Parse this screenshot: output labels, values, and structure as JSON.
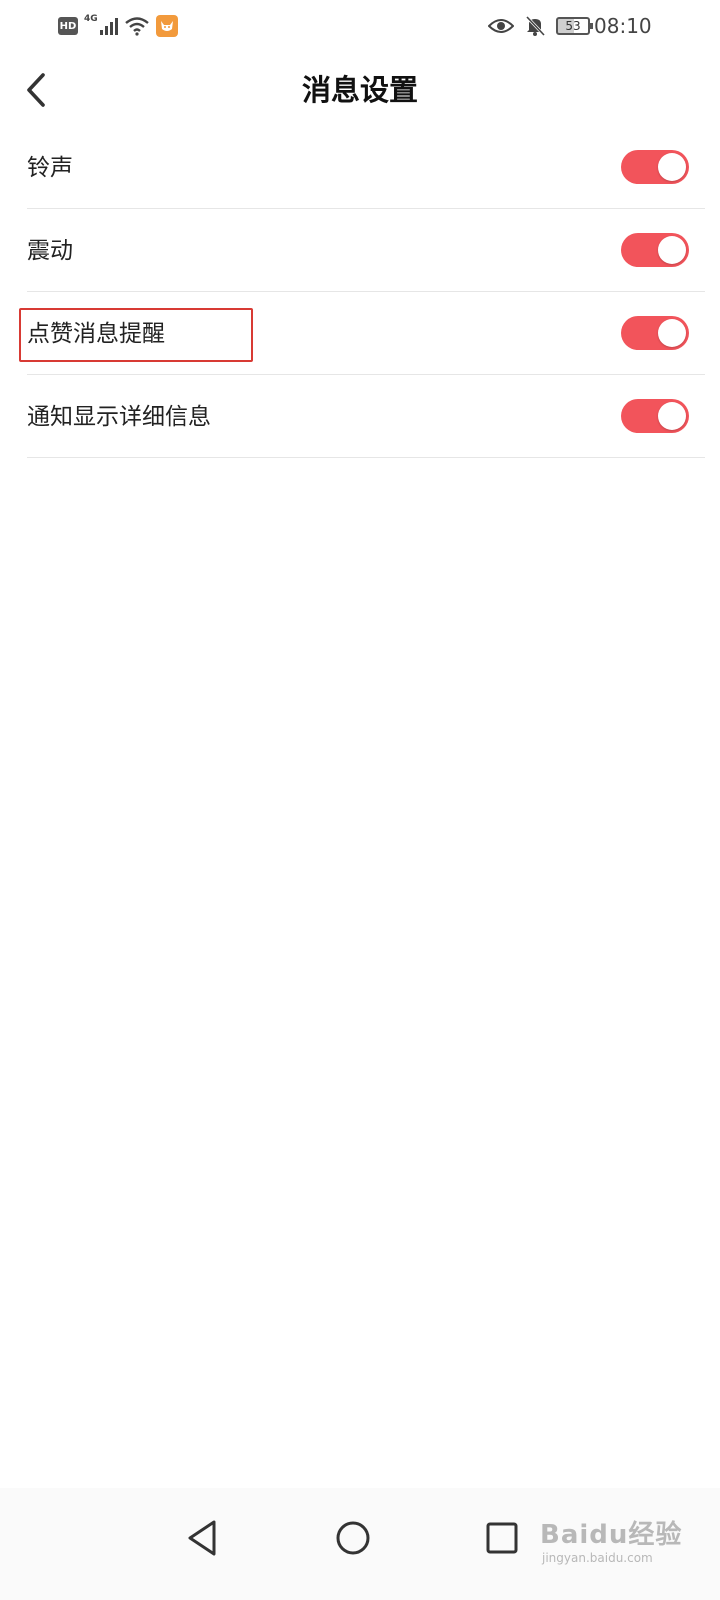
{
  "status_bar": {
    "hd": "HD",
    "network": "4G",
    "battery_level": "53",
    "time": "08:10",
    "icons": [
      "hd-icon",
      "signal-icon",
      "wifi-icon",
      "app-notification-icon",
      "eye-icon",
      "bell-muted-icon",
      "battery-icon"
    ]
  },
  "header": {
    "title": "消息设置",
    "back_icon": "chevron-left-icon"
  },
  "settings": {
    "items": [
      {
        "label": "铃声",
        "enabled": true
      },
      {
        "label": "震动",
        "enabled": true
      },
      {
        "label": "点赞消息提醒",
        "enabled": true,
        "highlighted": true
      },
      {
        "label": "通知显示详细信息",
        "enabled": true
      }
    ]
  },
  "nav_bar": {
    "icons": [
      "back-triangle-icon",
      "home-circle-icon",
      "recents-square-icon"
    ]
  },
  "watermark": {
    "logo": "Baidu经验",
    "url": "jingyan.baidu.com"
  },
  "colors": {
    "toggle_on": "#f2545b",
    "highlight_border": "#d83a34",
    "divider": "#e6e6e6"
  }
}
